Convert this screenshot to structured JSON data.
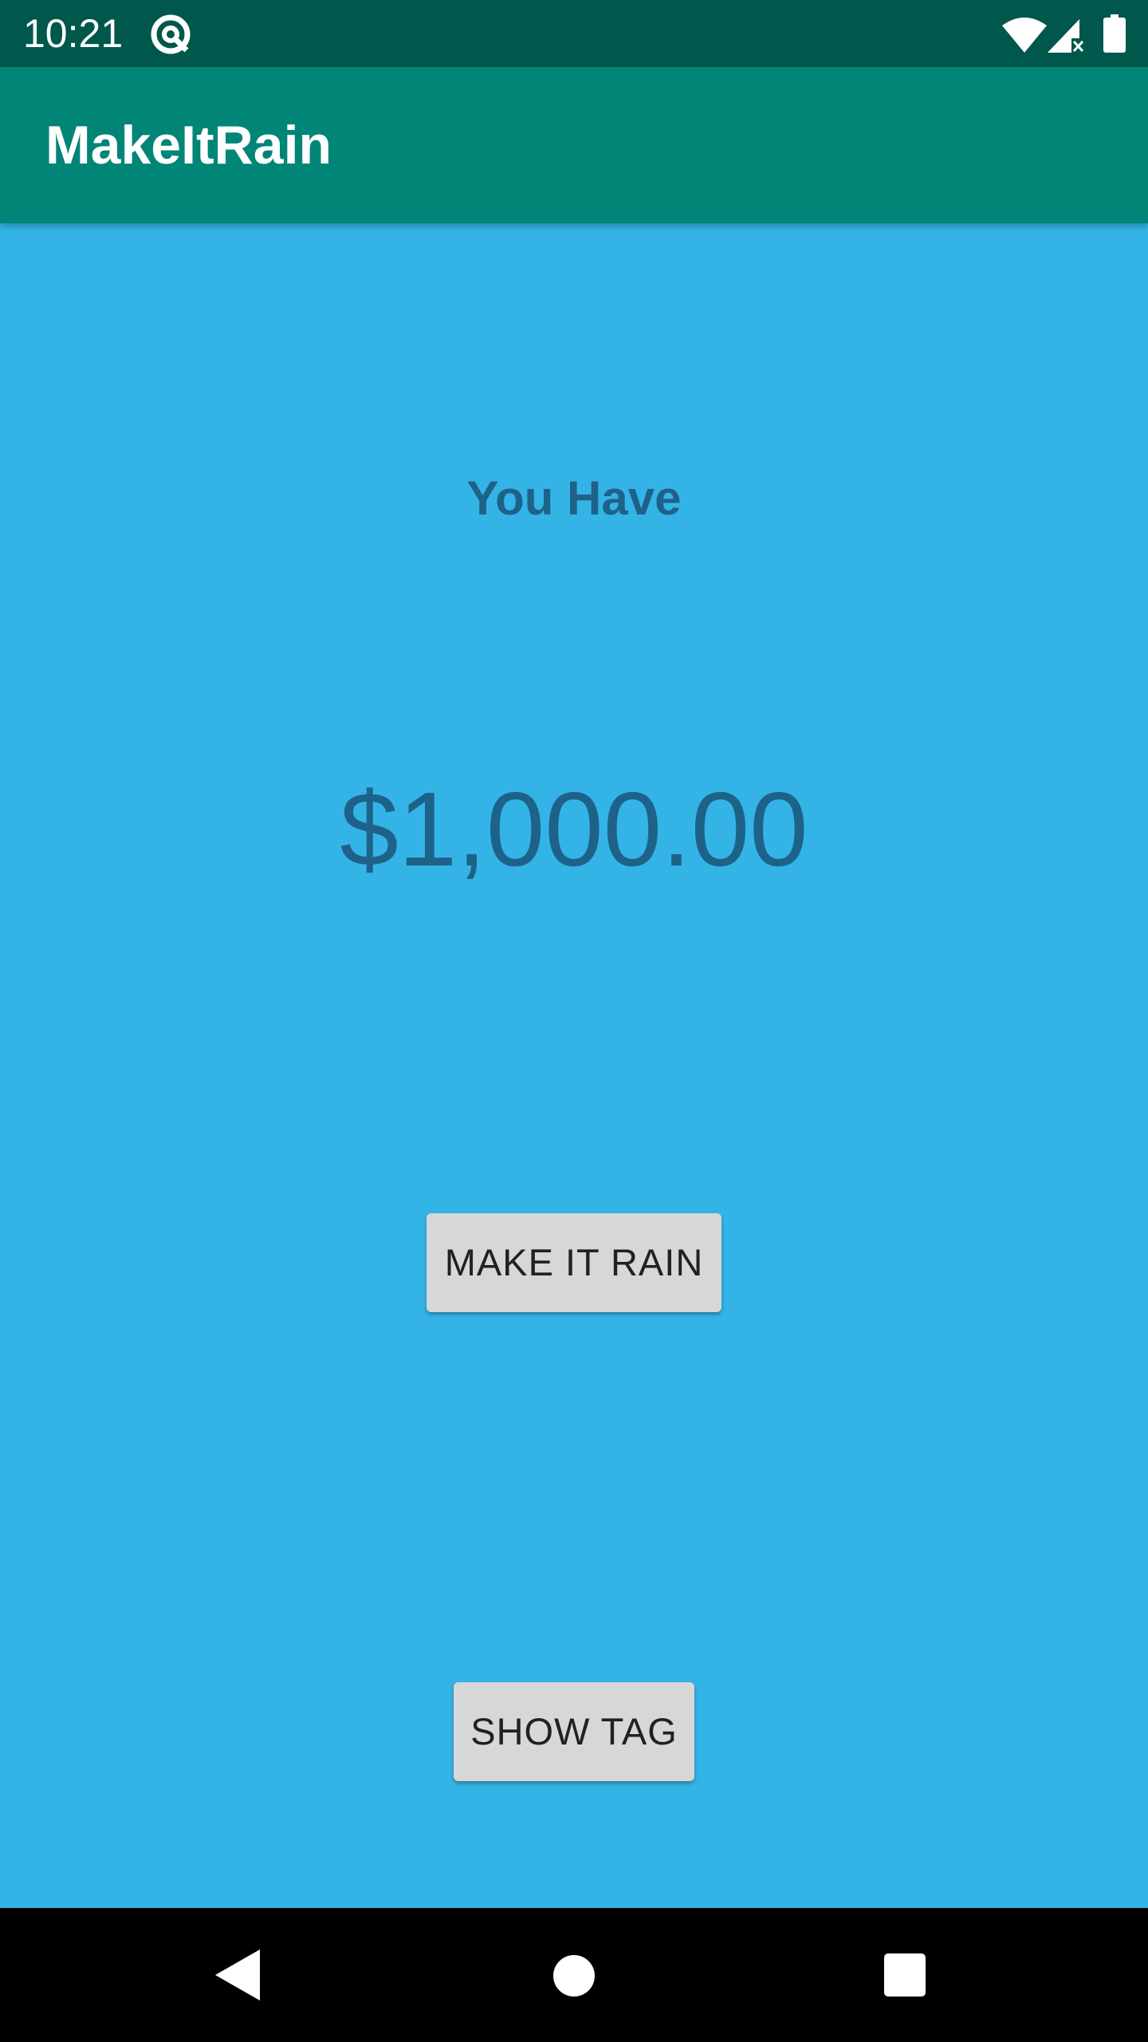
{
  "status_bar": {
    "time": "10:21",
    "icons": [
      "app-notification-icon",
      "wifi-icon",
      "signal-icon",
      "battery-icon"
    ]
  },
  "app_bar": {
    "title": "MakeItRain"
  },
  "main": {
    "label": "You Have",
    "amount": "$1,000.00",
    "make_it_rain_label": "MAKE IT RAIN",
    "show_tag_label": "SHOW TAG"
  },
  "nav_bar": {
    "icons": [
      "back-icon",
      "home-icon",
      "recents-icon"
    ]
  },
  "colors": {
    "background": "#34b4e6",
    "status_bar": "#00574b",
    "app_bar": "#008577",
    "text_dark_blue": "#1e6289",
    "button": "#d6d7d7",
    "nav_bar": "#000000"
  }
}
